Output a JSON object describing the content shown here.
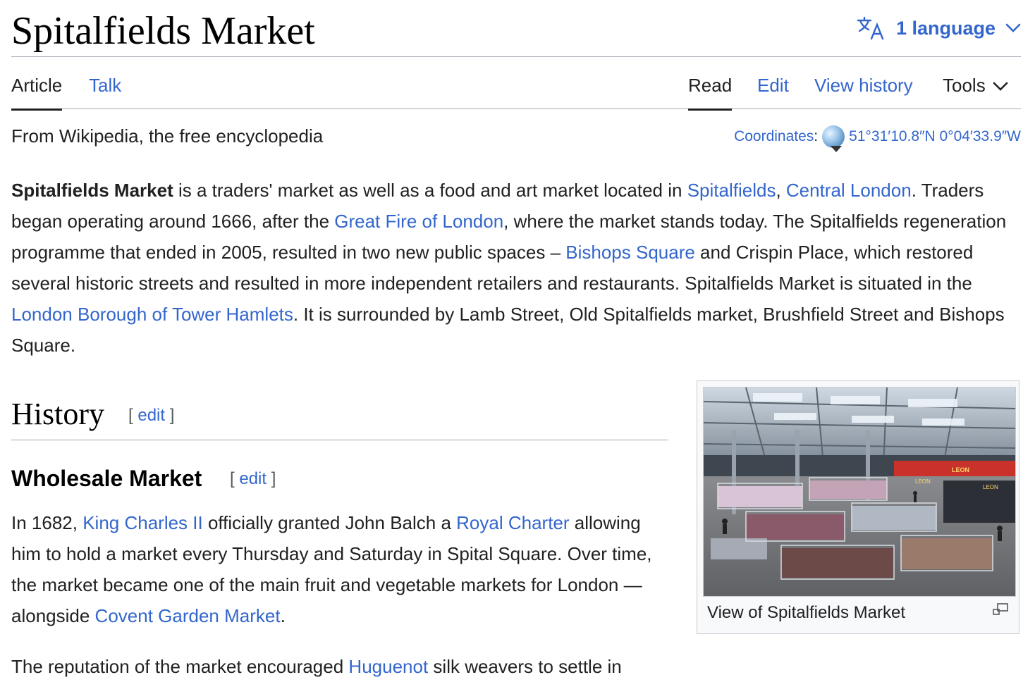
{
  "header": {
    "title": "Spitalfields Market",
    "language_label": "1 language",
    "language_icon": "translate-icon",
    "chevron_icon": "chevron-down-icon"
  },
  "tabs": {
    "article": "Article",
    "talk": "Talk",
    "read": "Read",
    "edit": "Edit",
    "view_history": "View history",
    "tools": "Tools"
  },
  "tagline": "From Wikipedia, the free encyclopedia",
  "coordinates": {
    "label": "Coordinates",
    "colon": ":",
    "value": "51°31′10.8″N 0°04′33.9″W",
    "icon": "globe-icon"
  },
  "lead": {
    "bold": "Spitalfields Market",
    "t1": " is a traders' market as well as a food and art market located in ",
    "link_spitalfields": "Spitalfields",
    "t2": ", ",
    "link_central_london": "Central London",
    "t3": ". Traders began operating around 1666, after the ",
    "link_great_fire": "Great Fire of London",
    "t4": ", where the market stands today. The Spitalfields regeneration programme that ended in 2005, resulted in two new public spaces – ",
    "link_bishops_square": "Bishops Square",
    "t5": " and Crispin Place, which restored several historic streets and resulted in more independent retailers and restaurants. Spitalfields Market is situated in the ",
    "link_tower_hamlets": "London Borough of Tower Hamlets",
    "t6": ". It is surrounded by Lamb Street, Old Spitalfields market, Brushfield Street and Bishops Square."
  },
  "sections": {
    "history": "History",
    "wholesale": "Wholesale Market",
    "edit_open": "[ ",
    "edit_label": "edit",
    "edit_close": " ]"
  },
  "body1": {
    "t1": "In 1682, ",
    "link_charles": "King Charles II",
    "t2": " officially granted John Balch a ",
    "link_charter": "Royal Charter",
    "t3": " allowing him to hold a market every Thursday and Saturday in Spital Square. Over time, the market became one of the main fruit and vegetable markets for London — alongside ",
    "link_covent": "Covent Garden Market",
    "t4": "."
  },
  "body2": {
    "t1": "The reputation of the market encouraged ",
    "link_huguenot": "Huguenot",
    "t2": " silk weavers to settle in"
  },
  "figure": {
    "caption": "View of Spitalfields Market",
    "signs": [
      "LEON",
      "LEON",
      "LEON"
    ],
    "magnify_icon": "magnify-icon"
  }
}
